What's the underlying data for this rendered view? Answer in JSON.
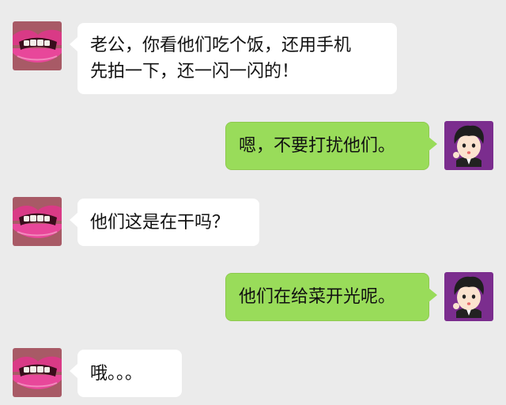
{
  "chat": {
    "messages": [
      {
        "sender": "wife",
        "text": "老公，你看他们吃个饭，还用手机\n先拍一下，还一闪一闪的！"
      },
      {
        "sender": "husband",
        "text": "嗯，不要打扰他们。"
      },
      {
        "sender": "wife",
        "text": "他们这是在干吗？"
      },
      {
        "sender": "husband",
        "text": "他们在给菜开光呢。"
      },
      {
        "sender": "wife",
        "text": "哦。。。"
      }
    ]
  },
  "avatars": {
    "wife": {
      "icon": "lips-avatar-icon"
    },
    "husband": {
      "icon": "cartoon-boy-avatar-icon",
      "background": "#7b2d8e"
    }
  },
  "colors": {
    "background": "#ebebeb",
    "left_bubble": "#ffffff",
    "right_bubble": "#99dc5a"
  }
}
